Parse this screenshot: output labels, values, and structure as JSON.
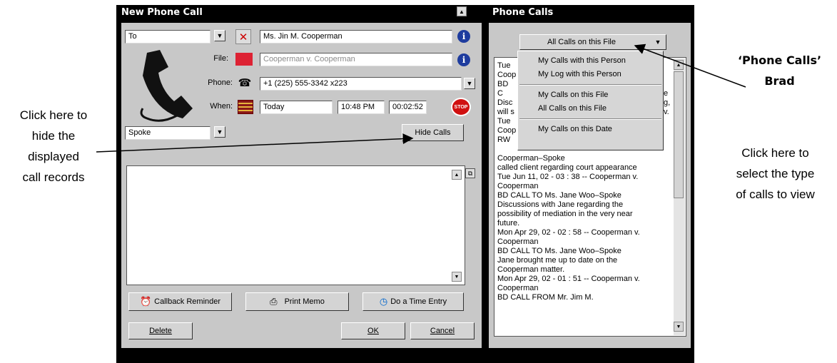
{
  "new_call": {
    "title": "New Phone Call",
    "direction": "To",
    "contact": "Ms. Jin M. Cooperman",
    "file_label": "File:",
    "file_value": "Cooperman v. Cooperman",
    "phone_label": "Phone:",
    "phone_value": "+1 (225) 555-3342 x223",
    "when_label": "When:",
    "when_date": "Today",
    "when_time": "10:48 PM",
    "when_duration": "00:02:52",
    "status": "Spoke",
    "hide_calls": "Hide Calls",
    "callback_reminder": "Callback Reminder",
    "print_memo": "Print Memo",
    "time_entry": "Do a Time Entry",
    "delete": "Delete",
    "ok": "OK",
    "cancel": "Cancel"
  },
  "phone_calls": {
    "title": "Phone Calls",
    "filter_selected": "All Calls on this File",
    "menu": {
      "group1": [
        "My Calls with this Person",
        "My Log with this Person"
      ],
      "group2": [
        "My Calls on this File",
        "All Calls on this File"
      ],
      "group3": [
        "My Calls on this Date"
      ]
    },
    "log_partial": [
      "Tue",
      "Coop",
      "BD C",
      "Disc",
      "will s",
      "Tue",
      "Coop",
      "RW"
    ],
    "log_partial_right": [
      "e",
      "g,",
      "v."
    ],
    "log": [
      "Cooperman–Spoke",
      "called client regarding court appearance",
      "Tue Jun 11, 02 - 03 : 38 -- Cooperman v.",
      "Cooperman",
      "BD CALL TO Ms. Jane Woo–Spoke",
      "Discussions with Jane regarding the",
      "possibility of mediation in the very near",
      "future.",
      "Mon Apr 29, 02 - 02 : 58 -- Cooperman v.",
      "Cooperman",
      "BD CALL TO Ms. Jane Woo–Spoke",
      "Jane brought me up to date on the",
      "Cooperman matter.",
      "Mon Apr 29, 02 - 01 : 51 -- Cooperman v.",
      "Cooperman",
      "BD CALL FROM Mr. Jim M."
    ]
  },
  "annotations": {
    "left": [
      "Click here to",
      "hide the",
      "displayed",
      "call records"
    ],
    "right_title": [
      "‘Phone Calls’",
      "Brad"
    ],
    "right": [
      "Click here to",
      "select the type",
      "of calls to view"
    ]
  }
}
